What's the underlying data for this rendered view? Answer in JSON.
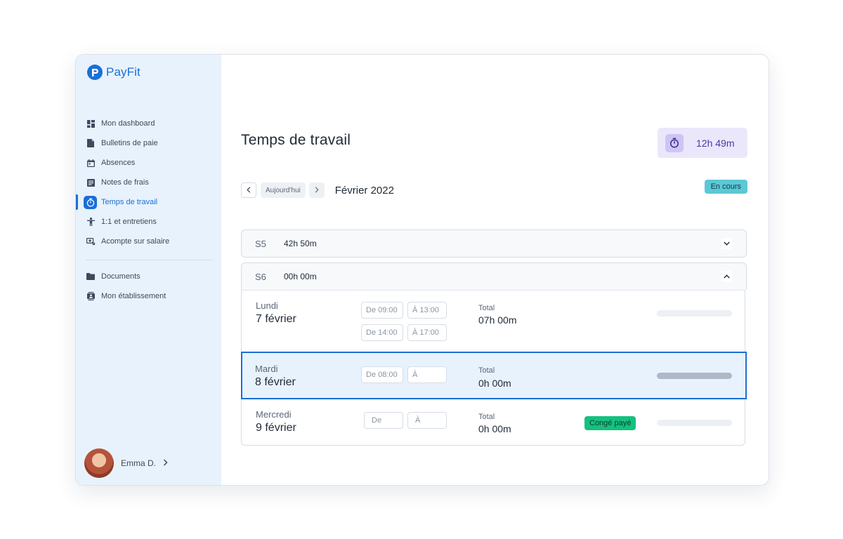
{
  "app": {
    "name": "PayFit"
  },
  "sidebar": {
    "items": [
      {
        "label": "Mon dashboard",
        "icon": "dashboard-icon"
      },
      {
        "label": "Bulletins de paie",
        "icon": "document-icon"
      },
      {
        "label": "Absences",
        "icon": "calendar-icon"
      },
      {
        "label": "Notes de frais",
        "icon": "receipt-icon"
      },
      {
        "label": "Temps de travail",
        "icon": "stopwatch-icon",
        "active": true
      },
      {
        "label": "1:1 et entretiens",
        "icon": "person-icon"
      },
      {
        "label": "Acompte sur salaire",
        "icon": "money-icon"
      }
    ],
    "secondary_items": [
      {
        "label": "Documents",
        "icon": "folder-icon"
      },
      {
        "label": "Mon établissement",
        "icon": "contact-card-icon"
      }
    ],
    "user": {
      "name": "Emma D."
    }
  },
  "page": {
    "title": "Temps de travail",
    "timer": {
      "value": "12h 49m"
    },
    "today_label": "Aujourd'hui",
    "month": "Février 2022",
    "status": "En cours"
  },
  "weeks": [
    {
      "label": "S5",
      "total": "42h 50m",
      "expanded": false
    },
    {
      "label": "S6",
      "total": "00h 00m",
      "expanded": true
    }
  ],
  "days": [
    {
      "name": "Lundi",
      "date": "7 février",
      "slots": [
        {
          "from": "De 09:00",
          "to": "À 13:00"
        },
        {
          "from": "De 14:00",
          "to": "À 17:00"
        }
      ],
      "total_label": "Total",
      "total": "07h 00m",
      "progress": 0
    },
    {
      "name": "Mardi",
      "date": "8 février",
      "slots": [
        {
          "from": "De 08:00",
          "to": "À"
        }
      ],
      "total_label": "Total",
      "total": "0h 00m",
      "progress": 1,
      "selected": true
    },
    {
      "name": "Mercredi",
      "date": "9 février",
      "slots": [
        {
          "from": "De",
          "to": "À"
        }
      ],
      "total_label": "Total",
      "total": "0h 00m",
      "badge": "Congé payé",
      "progress": 0
    }
  ],
  "colors": {
    "accent": "#1a6fd6",
    "sidebar_bg": "#e8f2fd",
    "timer_bg": "#ebe7fb",
    "status_badge": "#5bc8d6",
    "leave_badge": "#16c07f"
  }
}
